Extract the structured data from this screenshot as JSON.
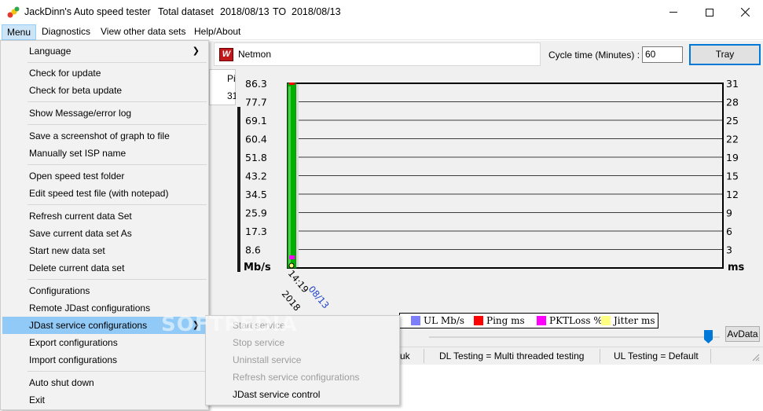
{
  "titlebar": {
    "app_name": "JackDinn's Auto speed tester",
    "total_label": "Total dataset",
    "date_from": "2018/08/13",
    "to_label": "TO",
    "date_to": "2018/08/13"
  },
  "menubar": {
    "items": [
      "Menu",
      "Diagnostics",
      "View other data sets",
      "Help/About"
    ]
  },
  "netmon": {
    "label": "Netmon",
    "icon_letter": "W"
  },
  "cycle": {
    "label": "Cycle time (Minutes) :",
    "value": "60"
  },
  "tray_label": "Tray",
  "side_column": {
    "header": "Pi",
    "value": "31"
  },
  "chart_data": {
    "type": "bar",
    "categories": [
      "14:19"
    ],
    "category_date": "08/13",
    "category_year": "2018",
    "series": [
      {
        "name": "UL Mb/s",
        "values": [
          0
        ]
      },
      {
        "name": "Ping ms",
        "values": [
          31
        ]
      },
      {
        "name": "PKTLoss %",
        "values": [
          0
        ]
      },
      {
        "name": "Jitter ms",
        "values": [
          0
        ]
      }
    ],
    "dl_values": [
      86.3
    ],
    "ylabel": "Mb/s",
    "y2label": "ms",
    "yticks": [
      "86.3",
      "77.7",
      "69.1",
      "60.4",
      "51.8",
      "43.2",
      "34.5",
      "25.9",
      "17.3",
      "8.6"
    ],
    "y2ticks": [
      "31",
      "28",
      "25",
      "22",
      "19",
      "15",
      "12",
      "9",
      "6",
      "3"
    ],
    "ylim": [
      0,
      86.3
    ],
    "y2lim": [
      0,
      31
    ],
    "grid": true,
    "legend_position": "bottom",
    "colors": {
      "dl": "#00b000",
      "ul": "#7d7dff",
      "ping": "#ff0000",
      "pktloss": "#ff00ff",
      "jitter": "#ffff80"
    }
  },
  "legend": {
    "items": [
      {
        "label": "UL Mb/s",
        "color": "#7d7dff"
      },
      {
        "label": "Ping ms",
        "color": "#ff0000"
      },
      {
        "label": "PKTLoss %",
        "color": "#ff00ff"
      },
      {
        "label": "Jitter ms",
        "color": "#ffff80"
      }
    ]
  },
  "avdata_label": "AvData",
  "status": {
    "seg1": "uk",
    "seg2": "DL Testing = Multi threaded testing",
    "seg3": "UL Testing = Default"
  },
  "menu": {
    "items": [
      {
        "label": "Language",
        "submenu": true
      },
      {
        "label": "Check for update"
      },
      {
        "label": "Check for beta update"
      },
      {
        "label": "Show Message/error log"
      },
      {
        "label": "Save a screenshot of graph to file"
      },
      {
        "label": "Manually set ISP name"
      },
      {
        "label": "Open speed test folder"
      },
      {
        "label": "Edit speed test file (with notepad)"
      },
      {
        "label": "Refresh current data Set"
      },
      {
        "label": "Save current data set As"
      },
      {
        "label": "Start new data set"
      },
      {
        "label": "Delete current data set"
      },
      {
        "label": "Configurations"
      },
      {
        "label": "Remote JDast configurations"
      },
      {
        "label": "JDast service configurations",
        "submenu": true
      },
      {
        "label": "Export configurations"
      },
      {
        "label": "Import configurations"
      },
      {
        "label": "Auto shut down"
      },
      {
        "label": "Exit"
      }
    ]
  },
  "submenu": {
    "items": [
      {
        "label": "Start service",
        "disabled": true
      },
      {
        "label": "Stop service",
        "disabled": true
      },
      {
        "label": "Uninstall service",
        "disabled": true
      },
      {
        "label": "Refresh service configurations",
        "disabled": true
      },
      {
        "label": "JDast service control",
        "disabled": false
      }
    ]
  },
  "watermark": "SOFTPEDIA"
}
